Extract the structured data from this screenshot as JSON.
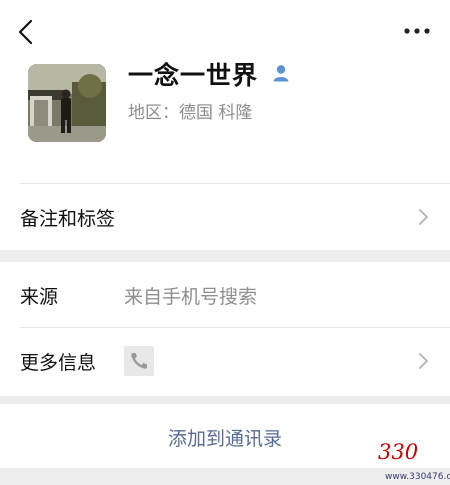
{
  "profile": {
    "name": "一念一世界",
    "region": "地区：德国 科隆"
  },
  "icons": {
    "back": "chevron-left-icon",
    "more": "more-dots-icon",
    "gender": "user-icon",
    "phone": "phone-icon",
    "chevron": "chevron-right-icon"
  },
  "rows": {
    "remarks_label": "备注和标签",
    "source_label": "来源",
    "source_value": "来自手机号搜索",
    "more_info_label": "更多信息"
  },
  "actions": {
    "add_contact": "添加到通讯录"
  },
  "watermark": {
    "number": "330",
    "url": "www.330476.com"
  },
  "colors": {
    "link": "#576b95",
    "background": "#ededed",
    "user_icon": "#5a93d8",
    "watermark_red": "#c40000"
  }
}
